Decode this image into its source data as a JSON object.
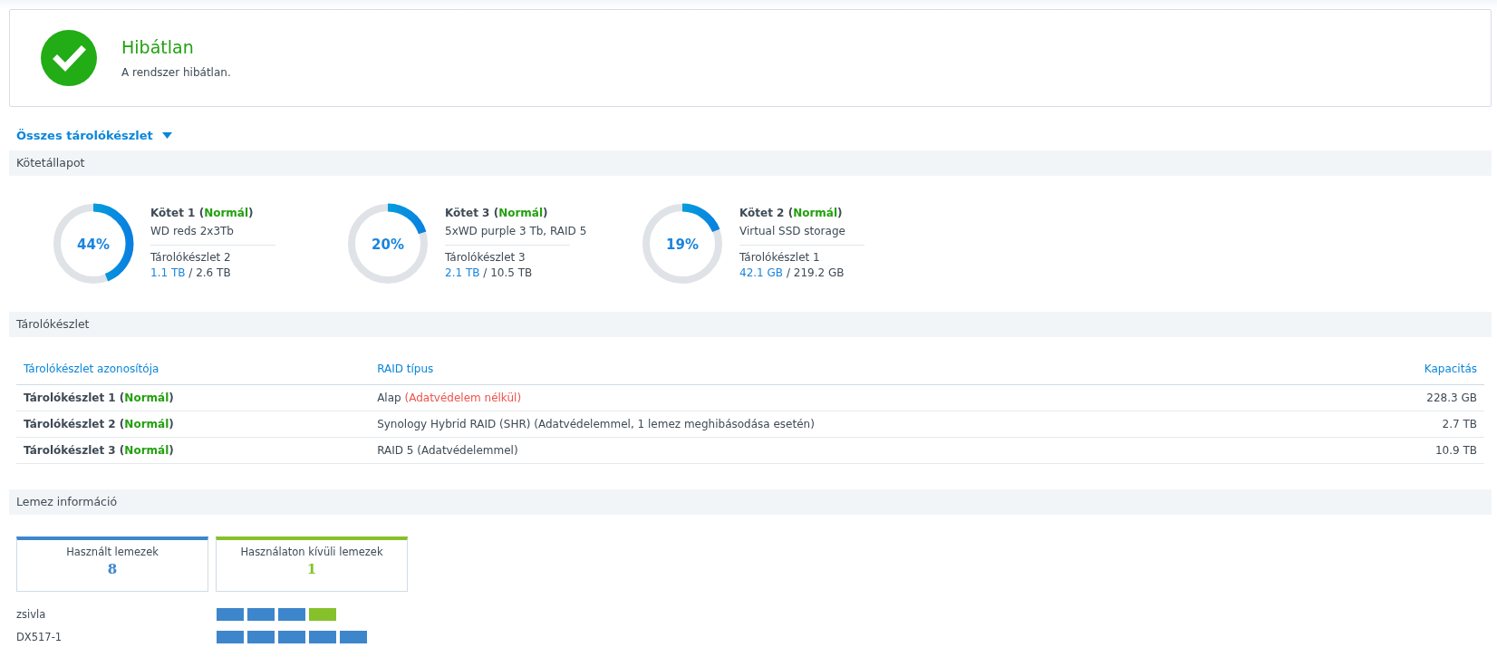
{
  "status": {
    "title": "Hibátlan",
    "message": "A rendszer hibátlan.",
    "healthy": true
  },
  "pool_filter": {
    "label": "Összes tárolókészlet"
  },
  "volume_section": {
    "title": "Kötetállapot"
  },
  "volumes": [
    {
      "title": "Kötet 1 (**Normál**)",
      "description": "WD reds 2x3Tb",
      "pool": "Tárolókészlet 2",
      "used": "1.1 TB",
      "total": "/ 2.6 TB",
      "percent": "44%",
      "level": 0.44
    },
    {
      "title": "Kötet 3 (**Normál**)",
      "description": "5xWD purple 3 Tb, RAID 5",
      "pool": "Tárolókészlet 3",
      "used": "2.1 TB",
      "total": "/ 10.5 TB",
      "percent": "20%",
      "level": 0.2
    },
    {
      "title": "Kötet 2 (**Normál**)",
      "description": "Virtual SSD storage",
      "pool": "Tárolókészlet 1",
      "used": "42.1 GB",
      "total": "/ 219.2 GB",
      "percent": "19%",
      "level": 0.19
    }
  ],
  "pool_section": {
    "title": "Tárolókészlet",
    "columns": [
      "Tárolókészlet azonosítója",
      "RAID típus",
      "Kapacitás"
    ],
    "rows": [
      {
        "name": "Tárolókészlet 1 (**Normál**)",
        "raid": "Alap",
        "warning": "(Adatvédelem nélkül)",
        "capacity": "228.3 GB"
      },
      {
        "name": "Tárolókészlet 2 (**Normál**)",
        "raid": "Synology Hybrid RAID (SHR) (Adatvédelemmel, 1 lemez meghibásodása esetén)",
        "capacity": "2.7 TB"
      },
      {
        "name": "Tárolókészlet 3 (**Normál**)",
        "raid": "RAID 5 (Adatvédelemmel)",
        "capacity": "10.9 TB"
      }
    ]
  },
  "disk_section": {
    "title": "Lemez információ",
    "summary": [
      {
        "label": "Használt lemezek",
        "count": "8",
        "kind": "used"
      },
      {
        "label": "Használaton kívüli lemezek",
        "count": "1",
        "kind": "unused"
      }
    ],
    "units": [
      {
        "name": "zsivla",
        "disks": [
          {
            "used": true
          },
          {
            "used": true
          },
          {
            "used": true
          },
          {
            "used": false
          }
        ]
      },
      {
        "name": "DX517-1",
        "disks": [
          {
            "used": true
          },
          {
            "used": true
          },
          {
            "used": true
          },
          {
            "used": true
          },
          {
            "used": true
          }
        ]
      }
    ]
  }
}
